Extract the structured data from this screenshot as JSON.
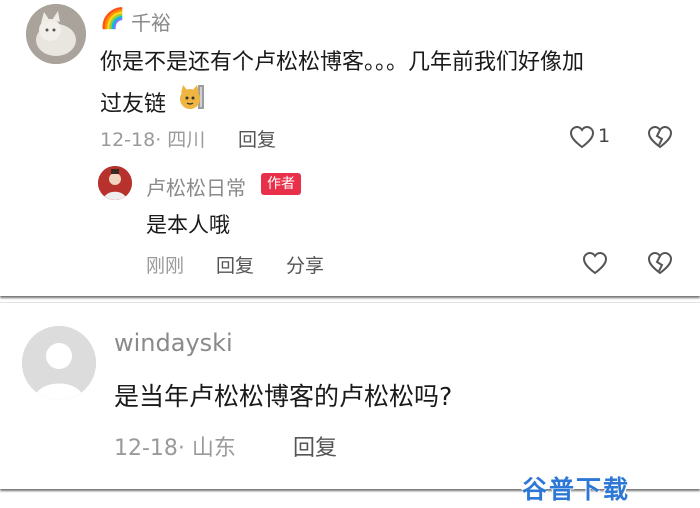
{
  "comments": [
    {
      "user": "千裕",
      "user_prefix_icon": "rainbow-icon",
      "text_line1": "你是不是还有个卢松松博客。。。几年前我们好像加",
      "text_line2": "过友链",
      "sticker": "cat-emoji-icon",
      "meta": "12-18· 四川",
      "reply_label": "回复",
      "like_count": "1",
      "reply": {
        "user": "卢松松日常",
        "badge": "作者",
        "text": "是本人哦",
        "meta": "刚刚",
        "reply_label": "回复",
        "share_label": "分享"
      }
    },
    {
      "user": "windayski",
      "text": "是当年卢松松博客的卢松松吗?",
      "meta": "12-18· 山东",
      "reply_label": "回复"
    }
  ],
  "watermark": "谷普下载",
  "colors": {
    "badge": "#e8304a",
    "watermark": "#2d78d6"
  }
}
